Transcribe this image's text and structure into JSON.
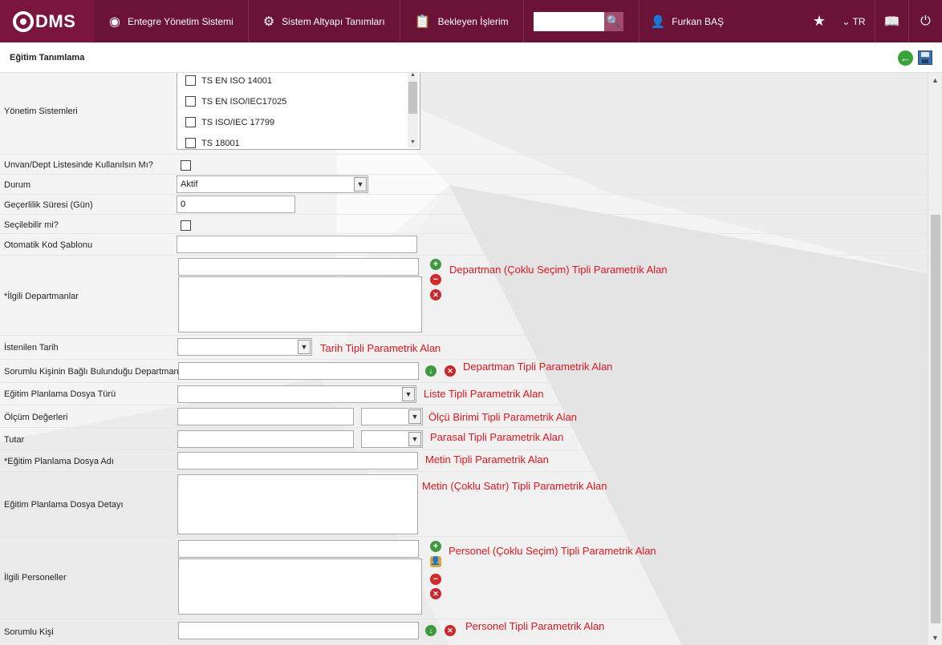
{
  "app": {
    "logo_text": "DMS"
  },
  "nav": [
    {
      "label": "Entegre Yönetim Sistemi",
      "icon": "circle-q-icon"
    },
    {
      "label": "Sistem Altyapı Tanımları",
      "icon": "gear-icon"
    },
    {
      "label": "Bekleyen İşlerim",
      "icon": "clipboard-icon"
    }
  ],
  "search": {
    "value": "",
    "placeholder": ""
  },
  "user": {
    "name": "Furkan BAŞ"
  },
  "language": "TR",
  "page": {
    "title": "Eğitim Tanımlama"
  },
  "form": {
    "yonetim_sistemleri": {
      "label": "Yönetim Sistemleri",
      "options": [
        "TS EN ISO 14001",
        "TS EN ISO/IEC17025",
        "TS ISO/IEC 17799",
        "TS 18001"
      ]
    },
    "unvan_dept": {
      "label": "Unvan/Dept Listesinde Kullanılsın Mı?",
      "checked": false
    },
    "durum": {
      "label": "Durum",
      "value": "Aktif"
    },
    "gecerlilik": {
      "label": "Geçerlilik Süresi (Gün)",
      "value": "0"
    },
    "secilebilir": {
      "label": "Seçilebilir mi?",
      "checked": false
    },
    "otomatik_kod": {
      "label": "Otomatik Kod Şablonu",
      "value": ""
    },
    "ilgili_departmanlar": {
      "label": "*İlgili Departmanlar",
      "annotation": "Departman (Çoklu Seçim) Tipli Parametrik Alan"
    },
    "istenilen_tarih": {
      "label": "İstenilen Tarih",
      "value": "",
      "annotation": "Tarih Tipli Parametrik Alan"
    },
    "sorumlu_departman": {
      "label": "Sorumlu Kişinin Bağlı Bulunduğu Departman",
      "value": "",
      "annotation": "Departman Tipli Parametrik Alan"
    },
    "dosya_turu": {
      "label": "Eğitim Planlama Dosya Türü",
      "value": "",
      "annotation": "Liste Tipli Parametrik Alan"
    },
    "olcum": {
      "label": "Ölçüm Değerleri",
      "value": "",
      "unit": "",
      "annotation": "Ölçü Birimi Tipli Parametrik Alan"
    },
    "tutar": {
      "label": "Tutar",
      "value": "",
      "currency": "",
      "annotation": "Parasal Tipli Parametrik Alan"
    },
    "dosya_adi": {
      "label": "*Eğitim Planlama Dosya Adı",
      "value": "",
      "annotation": "Metin Tipli Parametrik Alan"
    },
    "dosya_detayi": {
      "label": "Eğitim Planlama Dosya Detayı",
      "value": "",
      "annotation": "Metin (Çoklu Satır) Tipli Parametrik Alan"
    },
    "ilgili_personeller": {
      "label": "İlgili Personeller",
      "annotation": "Personel (Çoklu Seçim) Tipli Parametrik Alan"
    },
    "sorumlu_kisi": {
      "label": "Sorumlu Kişi",
      "value": "",
      "annotation": "Personel Tipli Parametrik Alan"
    }
  },
  "colors": {
    "topbar": "#6b1336",
    "annotation": "#e0151d",
    "add_icon": "#3f9a3f",
    "remove_icon": "#d12a2a"
  }
}
